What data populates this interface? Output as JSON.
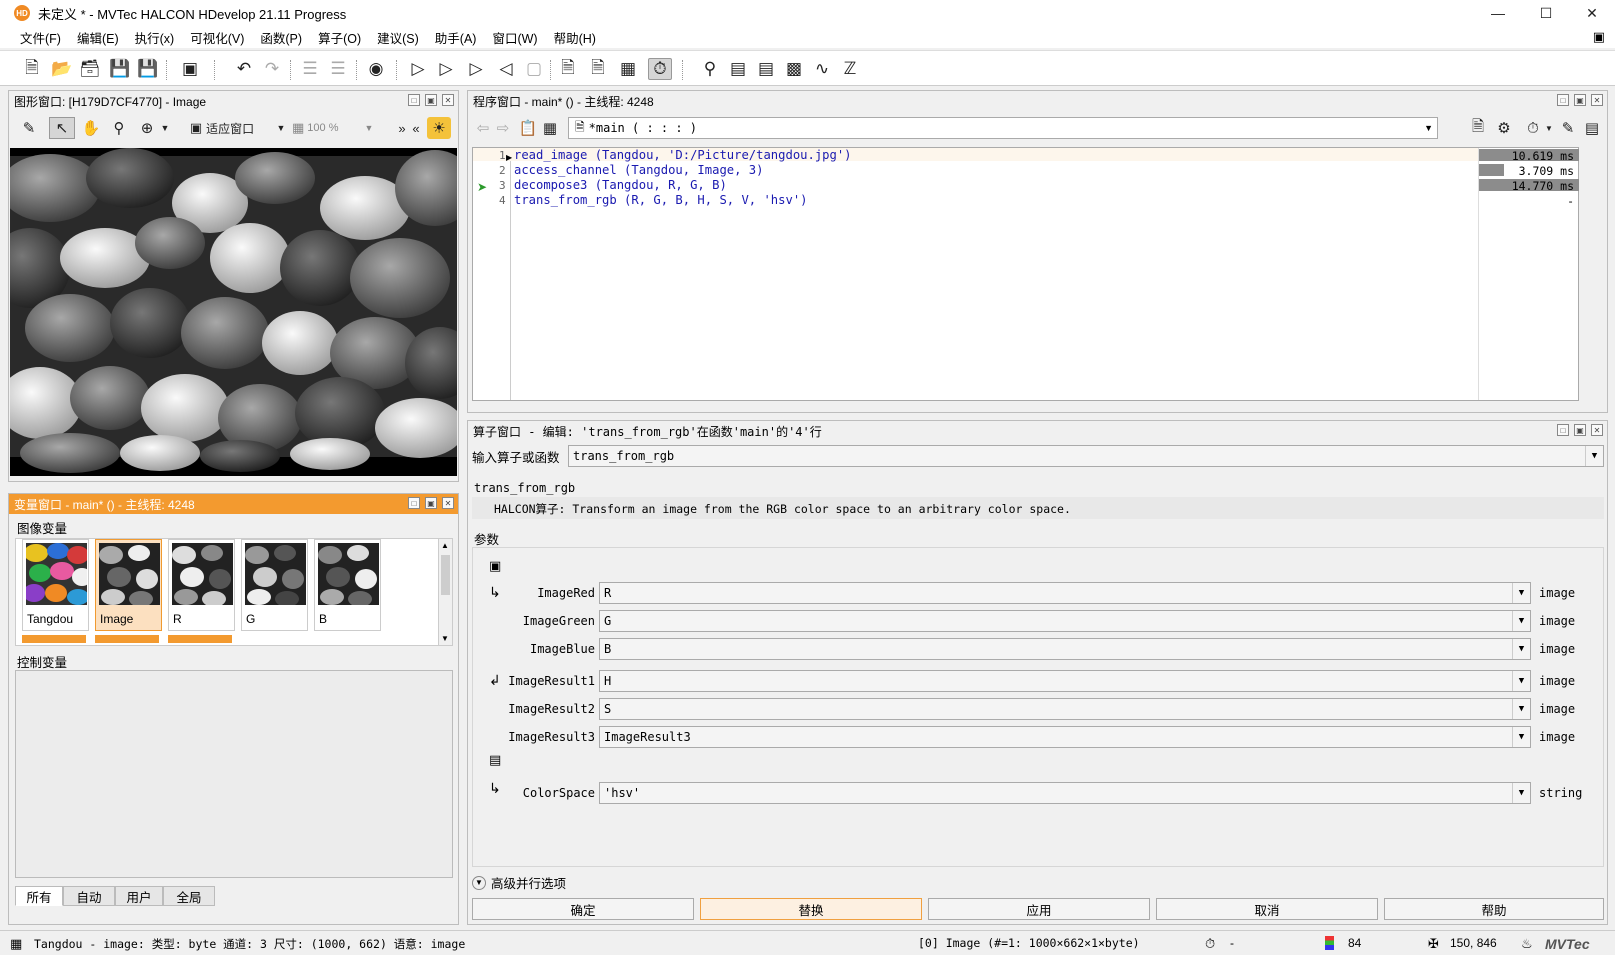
{
  "window": {
    "app_icon": "HD",
    "title": "未定义 * - MVTec HALCON HDevelop 21.11 Progress",
    "controls": [
      "minimize-icon",
      "maximize-icon",
      "close-icon"
    ]
  },
  "menu": [
    "文件(F)",
    "编辑(E)",
    "执行(x)",
    "可视化(V)",
    "函数(P)",
    "算子(O)",
    "建议(S)",
    "助手(A)",
    "窗口(W)",
    "帮助(H)"
  ],
  "graphics_window": {
    "title": "图形窗口: [H179D7CF4770] - Image",
    "fit_label": "适应窗口",
    "zoom": "100 %"
  },
  "program_window": {
    "title": "程序窗口 - main* () - 主线程: 4248",
    "procedure": "*main ( : : : )",
    "lines": [
      {
        "num": "1",
        "code": "read_image (Tangdou, 'D:/Picture/tangdou.jpg')",
        "time": "10.619 ms",
        "bar": 1.0
      },
      {
        "num": "2",
        "code": "access_channel (Tangdou, Image, 3)",
        "time": "3.709 ms",
        "bar": 0.25
      },
      {
        "num": "3",
        "code": "decompose3 (Tangdou, R, G, B)",
        "time": "14.770 ms",
        "bar": 1.0
      },
      {
        "num": "4",
        "code": "trans_from_rgb (R, G, B, H, S, V, 'hsv')",
        "time": "-",
        "bar": 0
      }
    ]
  },
  "operator_window": {
    "title": "算子窗口 - 编辑: 'trans_from_rgb'在函数'main'的'4'行",
    "input_label": "输入算子或函数",
    "input_value": "trans_from_rgb",
    "operator_name": "trans_from_rgb",
    "description": "HALCON算子: Transform an image from the RGB color space to an arbitrary color space.",
    "params_label": "参数",
    "params": [
      {
        "name": "ImageRed",
        "value": "R",
        "type": "image"
      },
      {
        "name": "ImageGreen",
        "value": "G",
        "type": "image"
      },
      {
        "name": "ImageBlue",
        "value": "B",
        "type": "image"
      },
      {
        "name": "ImageResult1",
        "value": "H",
        "type": "image"
      },
      {
        "name": "ImageResult2",
        "value": "S",
        "type": "image"
      },
      {
        "name": "ImageResult3",
        "value": "ImageResult3",
        "type": "image"
      },
      {
        "name": "ColorSpace",
        "value": "'hsv'",
        "type": "string"
      }
    ],
    "advanced": "高级并行选项",
    "buttons": [
      "确定",
      "替换",
      "应用",
      "取消",
      "帮助"
    ]
  },
  "variable_window": {
    "title": "变量窗口 - main* () - 主线程: 4248",
    "iconic_label": "图像变量",
    "thumbs": [
      "Tangdou",
      "Image",
      "R",
      "G",
      "B"
    ],
    "control_label": "控制变量",
    "tabs": [
      "所有",
      "自动",
      "用户",
      "全局"
    ]
  },
  "statusbar": {
    "left": "Tangdou - image: 类型: byte 通道: 3 尺寸: (1000, 662) 语意: image",
    "image_info": "[0] Image (#=1: 1000×662×1×byte)",
    "timer": "-",
    "gray": "84",
    "coords": "150, 846"
  }
}
